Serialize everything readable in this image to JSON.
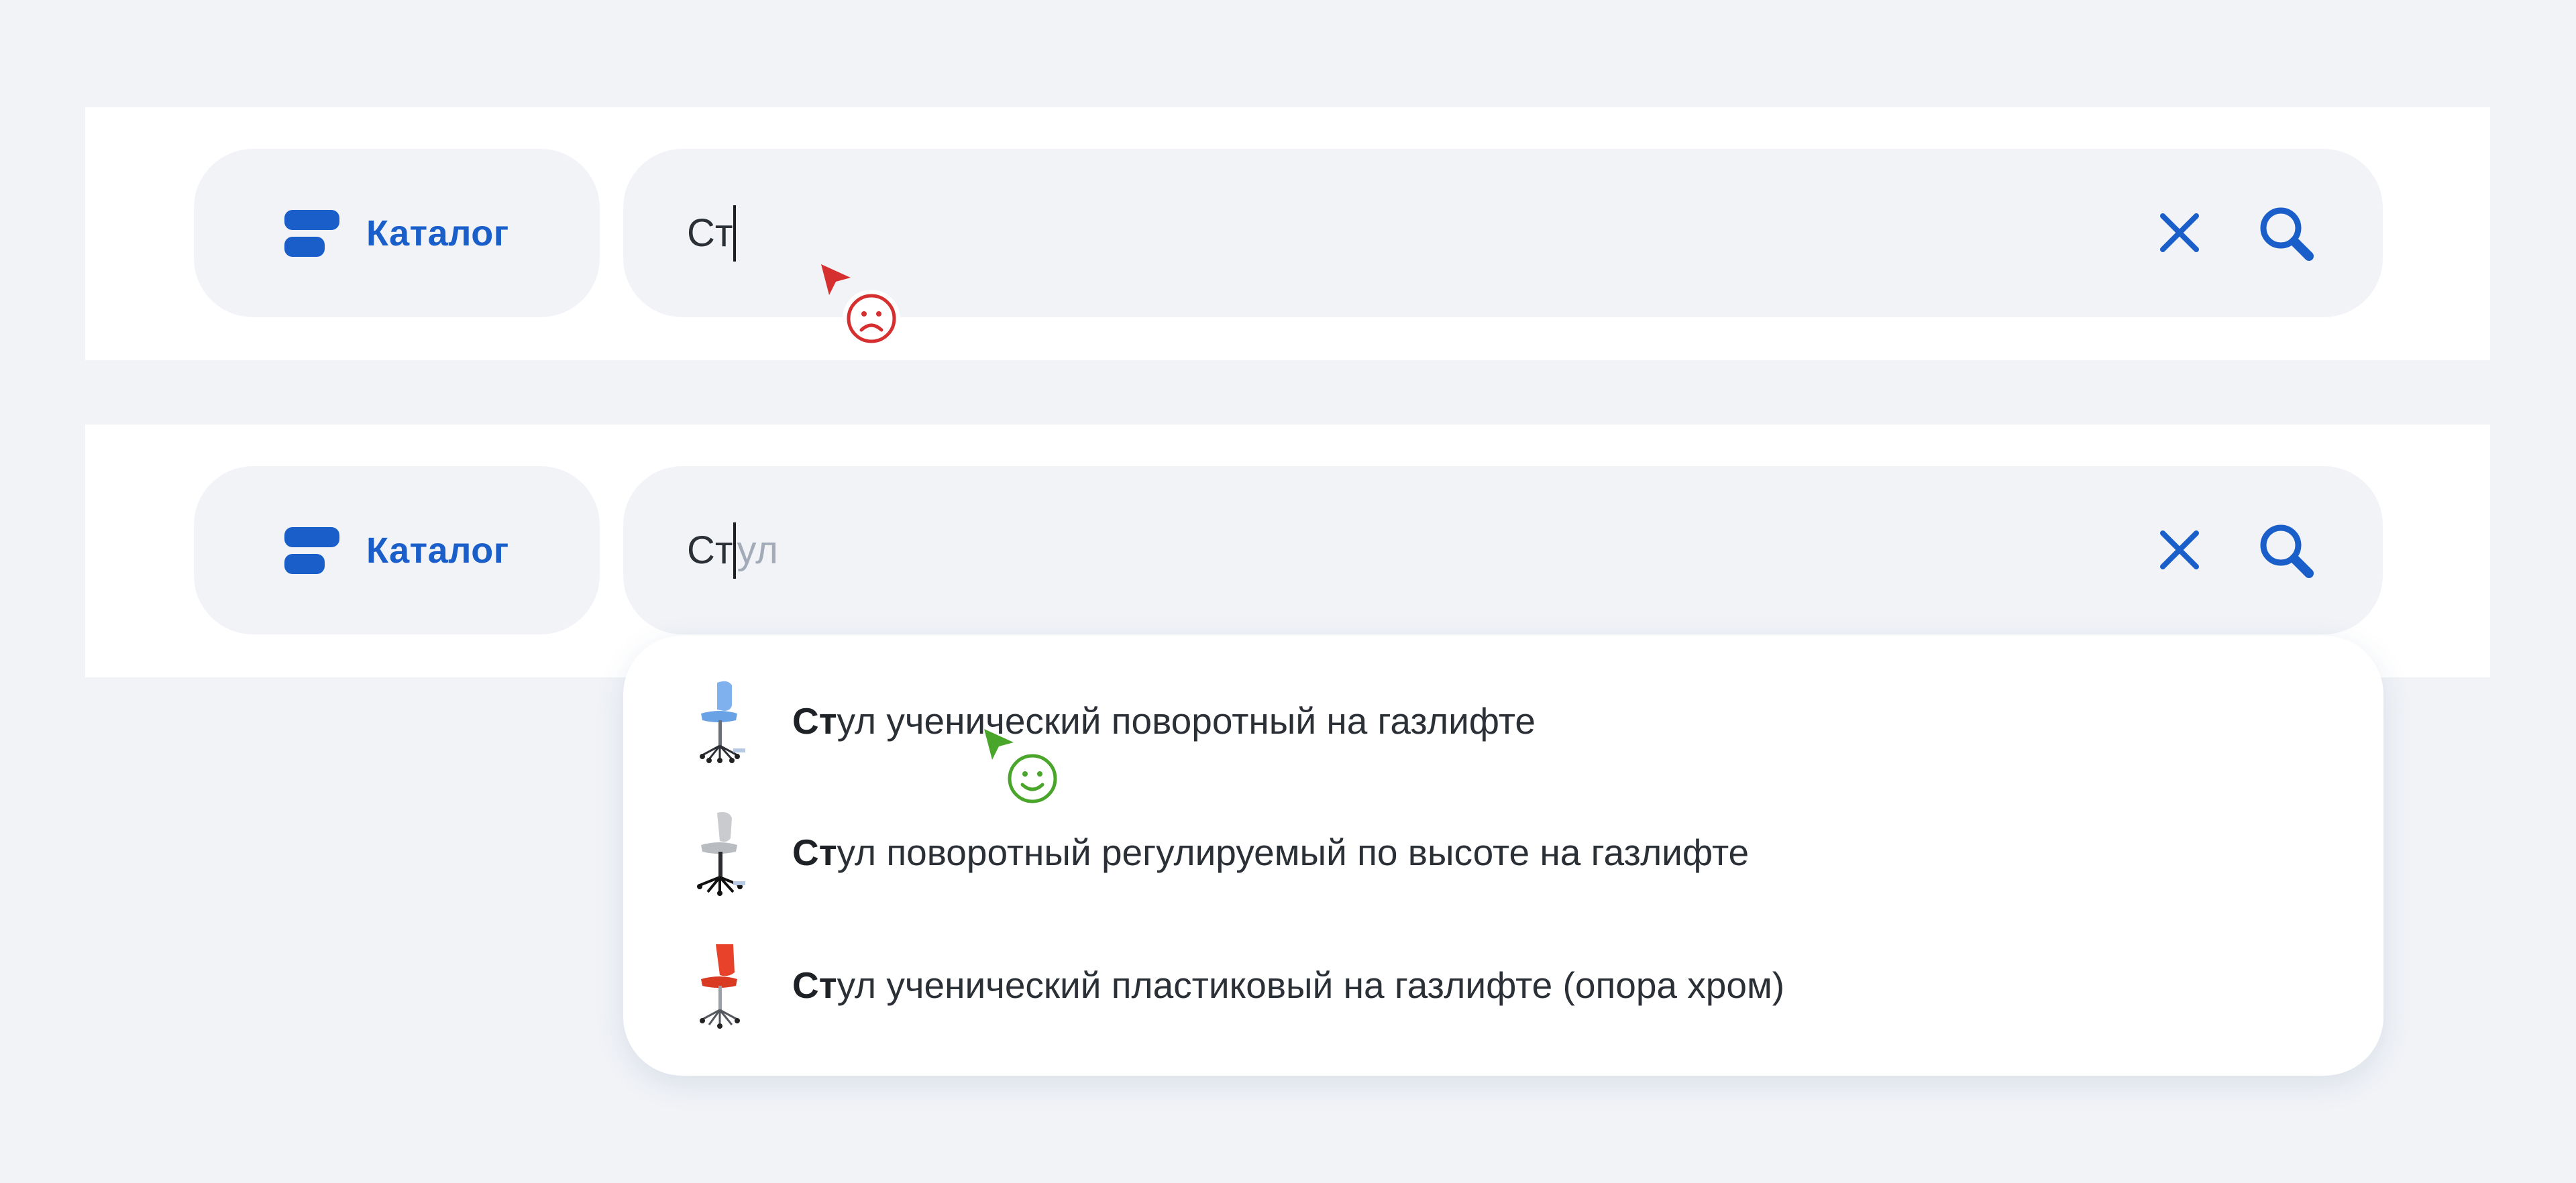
{
  "panels": [
    {
      "catalog_label": "Каталог",
      "query": "Ст",
      "suggestion_tail": "",
      "reaction": "frowning-face"
    },
    {
      "catalog_label": "Каталог",
      "query": "Ст",
      "suggestion_tail": "ул",
      "reaction": "smiling-face"
    }
  ],
  "dropdown": {
    "items": [
      {
        "match": "Ст",
        "rest": "ул ученический поворотный на газлифте",
        "thumb": "blue-chair-icon"
      },
      {
        "match": "Ст",
        "rest": "ул поворотный регулируемый по высоте на газлифте",
        "thumb": "grey-chair-icon"
      },
      {
        "match": "Ст",
        "rest": "ул ученический пластиковый на газлифте (опора хром)",
        "thumb": "red-chair-icon"
      }
    ]
  },
  "icons": {
    "catalog": "catalog-icon",
    "clear": "close-icon",
    "search": "search-icon"
  },
  "colors": {
    "background": "#f1f3f7",
    "brand_blue": "#1a5fc9",
    "text": "#2b2f36",
    "suggest_text": "#a4abb8",
    "bad_reaction": "#d62f2f",
    "good_reaction": "#4aa52b"
  }
}
